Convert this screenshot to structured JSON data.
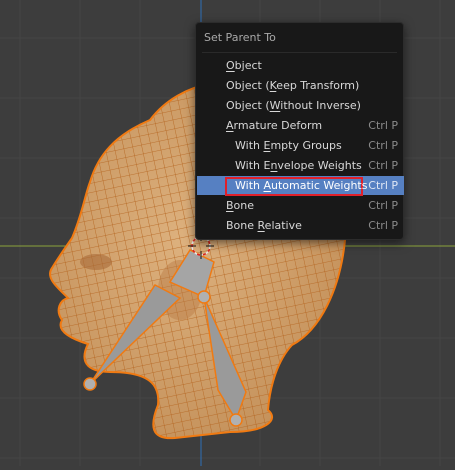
{
  "menu": {
    "title": "Set Parent To",
    "items": [
      {
        "pre": "",
        "u": "O",
        "post": "bject",
        "shortcut": ""
      },
      {
        "pre": "Object (",
        "u": "K",
        "post": "eep Transform)",
        "shortcut": ""
      },
      {
        "pre": "Object (",
        "u": "W",
        "post": "ithout Inverse)",
        "shortcut": ""
      },
      {
        "pre": "",
        "u": "A",
        "post": "rmature Deform",
        "shortcut": "Ctrl P"
      },
      {
        "pre": "With ",
        "u": "E",
        "post": "mpty Groups",
        "shortcut": "Ctrl P"
      },
      {
        "pre": "With E",
        "u": "n",
        "post": "velope Weights",
        "shortcut": "Ctrl P"
      },
      {
        "pre": "With ",
        "u": "A",
        "post": "utomatic Weights",
        "shortcut": "Ctrl P"
      },
      {
        "pre": "",
        "u": "B",
        "post": "one",
        "shortcut": "Ctrl P"
      },
      {
        "pre": "Bone ",
        "u": "R",
        "post": "elative",
        "shortcut": "Ctrl P"
      }
    ]
  },
  "colors": {
    "viewport_bg": "#3d3d3d",
    "grid_line": "#4a4a4a",
    "x_axis": "#8aa23a",
    "z_axis": "#2d6fb8",
    "mesh_fill": "#d3a773",
    "wire": "#c96a1a",
    "outline": "#f07a12",
    "bone": "#9a9a9a",
    "menu_bg": "#181818",
    "highlight": "#5680c2",
    "annotation": "#e0202a"
  }
}
